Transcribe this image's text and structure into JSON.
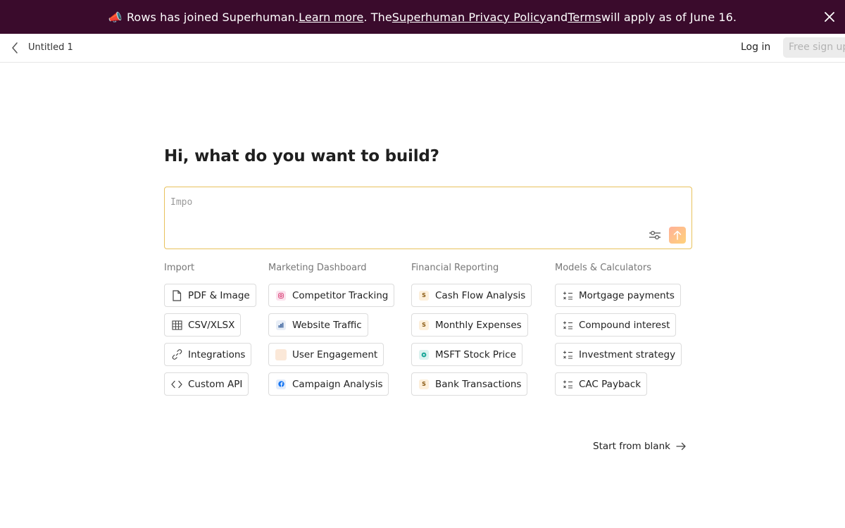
{
  "banner": {
    "text_1": "Rows has joined Superhuman. ",
    "link_learn_more": "Learn more",
    "text_2": ". The ",
    "link_privacy": "Superhuman Privacy Policy",
    "text_3": " and ",
    "link_terms": "Terms",
    "text_4": " will apply as of June 16.",
    "background": "#3a0b2c"
  },
  "topbar": {
    "doc_title": "Untitled 1",
    "login_label": "Log in",
    "signup_label": "Free sign up"
  },
  "main": {
    "headline": "Hi, what do you want to build?",
    "prompt_placeholder": "Impo",
    "accent": "#e8c15c"
  },
  "columns": [
    {
      "title": "Import",
      "items": [
        {
          "label": "PDF & Image",
          "icon": "file-icon"
        },
        {
          "label": "CSV/XLSX",
          "icon": "table-icon"
        },
        {
          "label": "Integrations",
          "icon": "link-icon"
        },
        {
          "label": "Custom API",
          "icon": "code-icon"
        }
      ]
    },
    {
      "title": "Marketing Dashboard",
      "items": [
        {
          "label": "Competitor Tracking",
          "icon": "instagram-icon"
        },
        {
          "label": "Website Traffic",
          "icon": "analytics-icon"
        },
        {
          "label": "User Engagement",
          "icon": "engagement-icon"
        },
        {
          "label": "Campaign Analysis",
          "icon": "facebook-icon"
        }
      ]
    },
    {
      "title": "Financial Reporting",
      "items": [
        {
          "label": "Cash Flow Analysis",
          "icon": "dollar-icon"
        },
        {
          "label": "Monthly Expenses",
          "icon": "dollar-icon"
        },
        {
          "label": "MSFT Stock Price",
          "icon": "stock-icon"
        },
        {
          "label": "Bank Transactions",
          "icon": "dollar-icon"
        }
      ]
    },
    {
      "title": "Models & Calculators",
      "items": [
        {
          "label": "Mortgage payments",
          "icon": "calculator-icon"
        },
        {
          "label": "Compound interest",
          "icon": "calculator-icon"
        },
        {
          "label": "Investment strategy",
          "icon": "calculator-icon"
        },
        {
          "label": "CAC Payback",
          "icon": "calculator-icon"
        }
      ]
    }
  ],
  "badge_letter": "S",
  "start_blank_label": "Start from blank"
}
